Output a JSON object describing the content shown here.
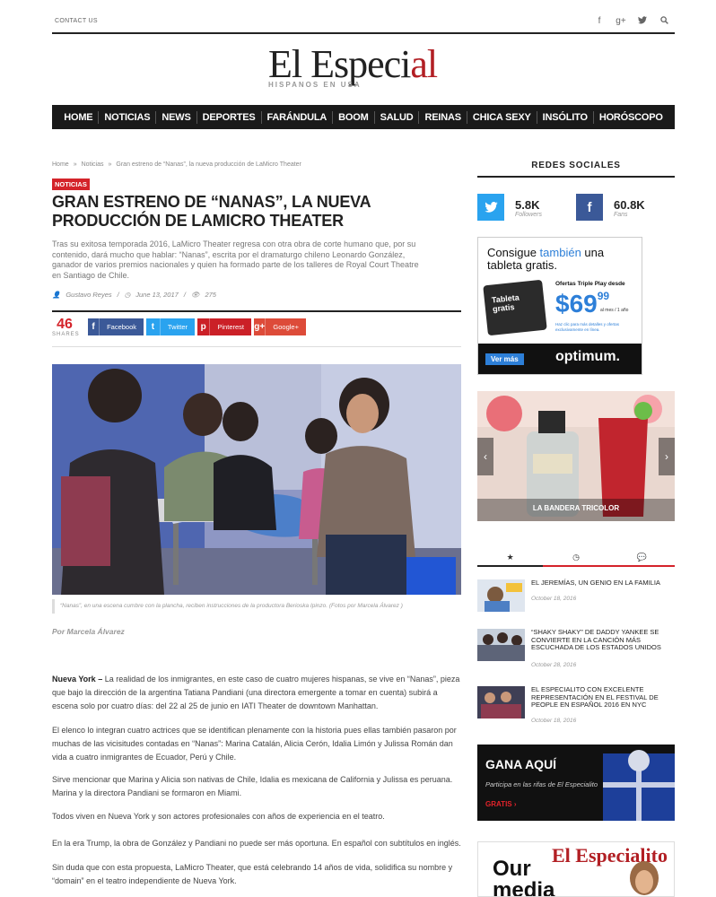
{
  "topbar": {
    "contact": "CONTACT US",
    "icons": [
      "facebook-icon",
      "google-plus-icon",
      "twitter-icon",
      "search-icon"
    ]
  },
  "logo": {
    "name_main": "El Especi",
    "name_accent": "al",
    "tagline": "HISPANOS EN USA"
  },
  "nav": [
    "HOME",
    "NOTICIAS",
    "NEWS",
    "DEPORTES",
    "FARÁNDULA",
    "BOOM",
    "SALUD",
    "REINAS",
    "CHICA SEXY",
    "INSÓLITO",
    "HORÓSCOPO"
  ],
  "breadcrumb": [
    "Home",
    "»",
    "Noticias",
    "»",
    "Gran estreno de “Nanas”, la nueva producción de LaMicro Theater"
  ],
  "article": {
    "category": "NOTICIAS",
    "title": "GRAN ESTRENO DE “NANAS”, LA NUEVA PRODUCCIÓN DE LAMICRO THEATER",
    "lead": "Tras su exitosa temporada 2016, LaMicro Theater regresa con otra obra de corte humano que, por su contenido, dará mucho que hablar: “Nanas”, escrita por el dramaturgo chileno Leonardo González, ganador de varios premios nacionales y quien ha formado parte de los talleres de Royal Court Theatre en Santiago de Chile.",
    "author": "Gustavo Reyes",
    "date": "June 13, 2017",
    "views": "275",
    "shares_count": "46",
    "shares_label": "SHARES",
    "share_buttons": {
      "facebook": "Facebook",
      "twitter": "Twitter",
      "pinterest": "Pinterest",
      "google": "Google+"
    },
    "caption": "“Nanas”, en una escena cumbre con la plancha, reciben instrucciones de la productora Berioska Ipinzo. (Fotos por Marcela Álvarez )",
    "byline": "Por Marcela Álvarez",
    "p1_lead": "Nueva York –",
    "p1": " La realidad de los inmigrantes, en este caso de cuatro mujeres hispanas, se vive en “Nanas”, pieza que bajo la dirección de la argentina Tatiana Pandiani (una directora emergente a tomar en cuenta) subirá a escena solo por cuatro días: del 22 al 25 de junio en IATI Theater de downtown Manhattan.",
    "p2": "El elenco lo integran cuatro actrices que se identifican plenamente con la historia pues ellas también pasaron por muchas de las vicisitudes contadas en “Nanas”: Marina Catalán, Alicia Cerón, Idalia Limón y Julissa Román dan vida a cuatro inmigrantes de Ecuador, Perú y Chile.",
    "p3": "Sirve mencionar que Marina y Alicia son nativas de Chile, Idalia es mexicana de California y Julissa es peruana. Marina y la directora Pandiani se formaron en Miami.",
    "p4": "Todos viven en Nueva York y son actores profesionales con años de experiencia en el teatro.",
    "p5": "En la era Trump, la obra de González y Pandiani no puede ser más oportuna. En español con subtítulos en inglés.",
    "p6": "Sin duda que con esta propuesta, LaMicro Theater, que está celebrando 14 años de vida, solidifica su nombre y “domain” en el teatro independiente de Nueva York."
  },
  "sidebar": {
    "redes_title": "REDES SOCIALES",
    "twitter_count": "5.8K",
    "twitter_label": "Followers",
    "facebook_count": "60.8K",
    "facebook_label": "Fans",
    "ad_optimum": {
      "head_a": "Consigue ",
      "head_b": "también",
      "head_c": " una",
      "head_d": "tableta gratis.",
      "offer": "Ofertas Triple Play desde",
      "price": "$69",
      "cents": "99",
      "per": "al mes / 1 año",
      "tablet": "Tableta gratis",
      "fine": "Haz clic para más detalles y ofertas exclusivamente en línea.",
      "cta": "Ver más",
      "brand": "optimum."
    },
    "slider_label": "LA BANDERA TRICOLOR",
    "tabs": [
      "★",
      "◷",
      "💬"
    ],
    "posts": [
      {
        "title": "EL JEREMÍAS, UN GENIO EN LA FAMILIA",
        "date": "October 18, 2016"
      },
      {
        "title": "“SHAKY SHAKY” DE DADDY YANKEE SE CONVIERTE EN LA CANCIÓN MÁS ESCUCHADA DE LOS ESTADOS UNIDOS",
        "date": "October 28, 2016"
      },
      {
        "title": "EL ESPECIALITO CON EXCELENTE REPRESENTACIÓN EN EL FESTIVAL DE PEOPLE EN ESPAÑOL 2016 EN NYC",
        "date": "October 18, 2016"
      }
    ],
    "gana": {
      "title": "GANA AQUÍ",
      "sub": "Participa en las rifas de El Especialito",
      "cta": "GRATIS ›"
    },
    "media": {
      "masthead": "El Especialito",
      "big1": "Our",
      "big2": "media"
    }
  },
  "colors": {
    "accent": "#d4232a",
    "nav_bg": "#1a1a1a",
    "facebook": "#3b5998",
    "twitter": "#2aa3ef"
  }
}
